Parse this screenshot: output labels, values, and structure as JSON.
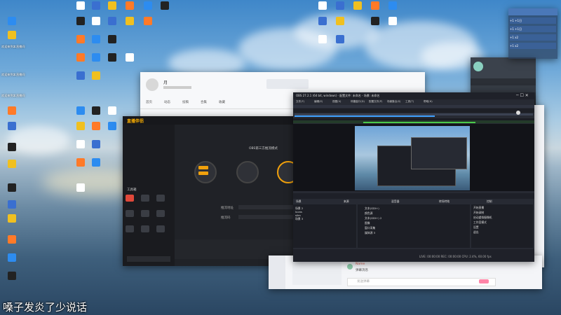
{
  "caption": "嗓子发炎了少说话",
  "desktop_icons": [
    {
      "name": "desktop-icon",
      "color": "#ffffff",
      "label": ""
    },
    {
      "name": "desktop-icon",
      "color": "#3a6fd0",
      "label": ""
    },
    {
      "name": "desktop-icon",
      "color": "#f0c020",
      "label": ""
    },
    {
      "name": "desktop-icon",
      "color": "#ff7a28",
      "label": ""
    },
    {
      "name": "desktop-icon",
      "color": "#2d8cf0",
      "label": ""
    },
    {
      "name": "desktop-icon",
      "color": "#222222",
      "label": ""
    }
  ],
  "notices": [
    "欢迎来到本直播间",
    "欢迎来到本直播间",
    "欢迎来到本直播间"
  ],
  "right_panel": {
    "rows": [
      {
        "label": "+1日",
        "value": "+1"
      },
      {
        "label": "+1日",
        "value": "+1"
      },
      {
        "label": "x2",
        "value": "+1"
      },
      {
        "label": "x2",
        "value": "+1"
      }
    ]
  },
  "profile_window": {
    "name": "月",
    "nav": [
      "首页",
      "动态",
      "投稿",
      "合集",
      "收藏"
    ],
    "tabs": [
      "关注",
      "粉丝"
    ]
  },
  "streamer_tool": {
    "title": "直播伴侣",
    "tabs": [
      "直播",
      "设置"
    ],
    "mode_label": "OBS第三方推流模式",
    "step_labels": [
      "推流地址",
      "推流码"
    ],
    "sidebar_label": "工具箱"
  },
  "obs": {
    "title": "OBS 27.2.1 (64 bit, windows) - 配置文件: 未命名 - 场景: 未命名",
    "menu": [
      "文件(F)",
      "编辑(E)",
      "视图(V)",
      "停靠窗口(D)",
      "配置文件(P)",
      "场景集合(S)",
      "工具(T)",
      "帮助(H)"
    ],
    "preview_label": "",
    "docks": [
      "场景",
      "来源",
      "混音器",
      "转场特效",
      "控制"
    ],
    "scenes": [
      "场景 2",
      "lucas",
      "slim",
      "场景 3"
    ],
    "sources": [
      "文本(GDI+)",
      "颜色源",
      "文本(GDI+) 2",
      "图像",
      "窗口采集",
      "媒体源 3"
    ],
    "controls": [
      "开始直播",
      "开始录制",
      "启动虚拟摄像机",
      "工作室模式",
      "设置",
      "退出"
    ],
    "status": "LIVE: 00:00:00  REC: 00:00:00  CPU: 2.4%, 60.00 fps"
  },
  "chat": {
    "messages": [
      "Name",
      "弹幕消息"
    ],
    "input_placeholder": "发送弹幕"
  },
  "gift_list": [
    "用户",
    "用户",
    "用户"
  ]
}
